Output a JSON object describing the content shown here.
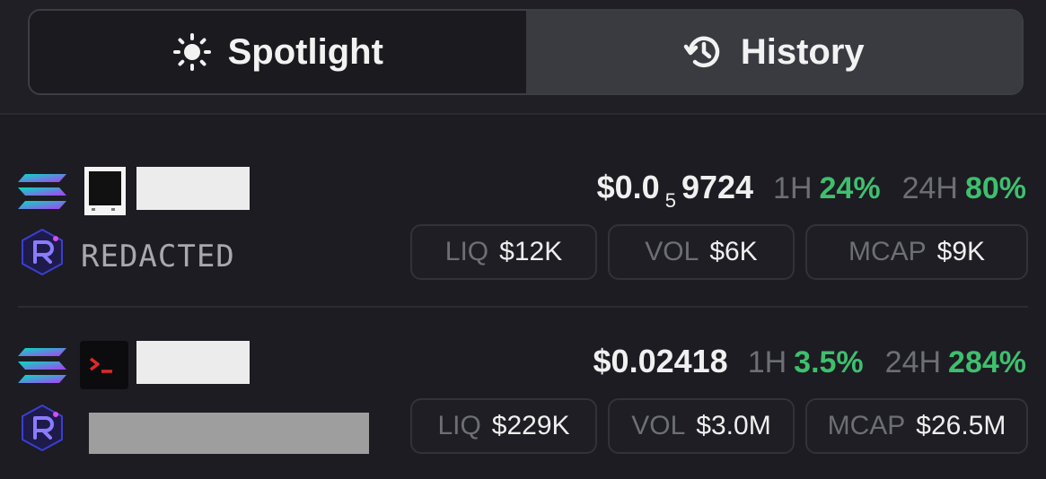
{
  "tabs": [
    {
      "label": "Spotlight",
      "icon": "sun-icon",
      "active": true
    },
    {
      "label": "History",
      "icon": "history-icon",
      "active": false
    }
  ],
  "tokens": [
    {
      "chain_icon": "solana-icon",
      "dex_icon": "raydium-icon",
      "token_icon": "square-token-icon",
      "name": "REDACTED",
      "price_prefix": "$0.0",
      "price_zeros": "5",
      "price_suffix": "9724",
      "h1_label": "1H",
      "h1_value": "24%",
      "h24_label": "24H",
      "h24_value": "80%",
      "liq_label": "LIQ",
      "liq_value": "$12K",
      "vol_label": "VOL",
      "vol_value": "$6K",
      "mcap_label": "MCAP",
      "mcap_value": "$9K"
    },
    {
      "chain_icon": "solana-icon",
      "dex_icon": "raydium-icon",
      "token_icon": "terminal-icon",
      "name": "",
      "price": "$0.02418",
      "h1_label": "1H",
      "h1_value": "3.5%",
      "h24_label": "24H",
      "h24_value": "284%",
      "liq_label": "LIQ",
      "liq_value": "$229K",
      "vol_label": "VOL",
      "vol_value": "$3.0M",
      "mcap_label": "MCAP",
      "mcap_value": "$26.5M"
    }
  ],
  "colors": {
    "positive": "#3fbf6e",
    "muted": "#6e6e76",
    "background": "#1c1c22"
  }
}
